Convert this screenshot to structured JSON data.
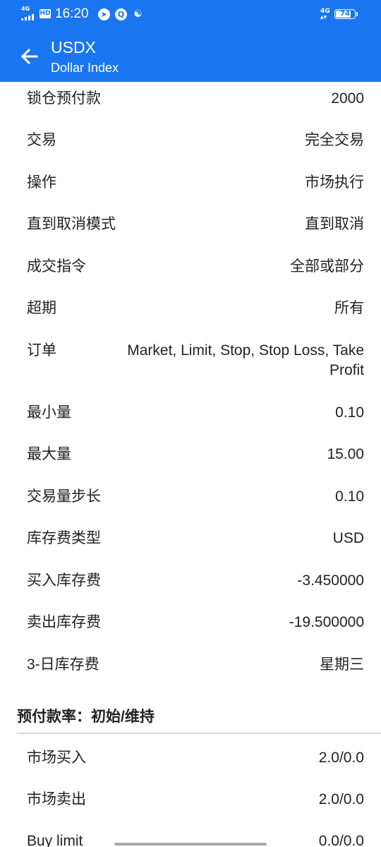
{
  "status_bar": {
    "network": "4G",
    "hd": "HD",
    "time": "16:20",
    "icons": [
      "navigation-icon",
      "qq-icon",
      "weibo-icon"
    ],
    "network_right": "4G",
    "battery": "74"
  },
  "app_bar": {
    "title": "USDX",
    "subtitle": "Dollar Index",
    "back_icon": "arrow-left-icon"
  },
  "specs": [
    {
      "label": "锁仓预付款",
      "value": "2000"
    },
    {
      "label": "交易",
      "value": "完全交易"
    },
    {
      "label": "操作",
      "value": "市场执行"
    },
    {
      "label": "直到取消模式",
      "value": "直到取消"
    },
    {
      "label": "成交指令",
      "value": "全部或部分"
    },
    {
      "label": "超期",
      "value": "所有"
    },
    {
      "label": "订单",
      "value": "Market, Limit, Stop, Stop Loss, Take Profit"
    },
    {
      "label": "最小量",
      "value": "0.10"
    },
    {
      "label": "最大量",
      "value": "15.00"
    },
    {
      "label": "交易量步长",
      "value": "0.10"
    },
    {
      "label": "库存费类型",
      "value": "USD"
    },
    {
      "label": "买入库存费",
      "value": "-3.450000"
    },
    {
      "label": "卖出库存费",
      "value": "-19.500000"
    },
    {
      "label": "3-日库存费",
      "value": "星期三"
    }
  ],
  "margin_section": {
    "title": "预付款率：初始/维持",
    "rows": [
      {
        "label": "市场买入",
        "value": "2.0/0.0"
      },
      {
        "label": "市场卖出",
        "value": "2.0/0.0"
      },
      {
        "label": "Buy limit",
        "value": "0.0/0.0"
      }
    ]
  },
  "colors": {
    "primary": "#1976f0",
    "text": "#222222",
    "divider": "#d9d9d9"
  }
}
